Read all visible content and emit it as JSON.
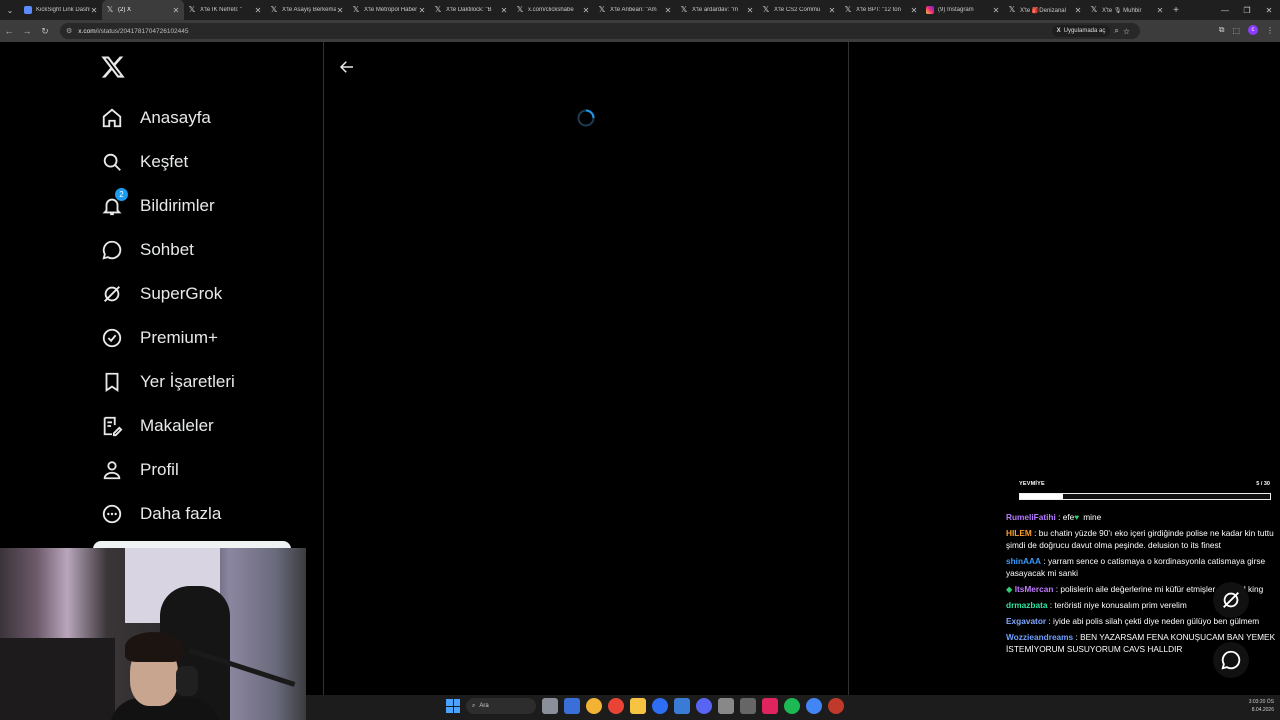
{
  "browser": {
    "tabs": [
      {
        "title": "KickSight Link Dashboard",
        "fav": "ks"
      },
      {
        "title": "(2) X",
        "fav": "x",
        "active": true
      },
      {
        "title": "X'te İK Nefreti: \"",
        "fav": "x"
      },
      {
        "title": "X'te Asayiş Berkemal",
        "fav": "x"
      },
      {
        "title": "X'te Metropol Haber",
        "fav": "x"
      },
      {
        "title": "X'te Daktilock: \"B",
        "fav": "x"
      },
      {
        "title": "x.com/clickshabe",
        "fav": "x"
      },
      {
        "title": "X'te Anbean: \"Am",
        "fav": "x"
      },
      {
        "title": "X'te ardardav: \"m",
        "fav": "x"
      },
      {
        "title": "X'te CS2 Commu",
        "fav": "x"
      },
      {
        "title": "X'te BPT: \"12 ton",
        "fav": "x"
      },
      {
        "title": "(9) Instagram",
        "fav": "ig"
      },
      {
        "title": "X'te 🎒Denizanal",
        "fav": "x"
      },
      {
        "title": "X'te 🎙 Muhbir",
        "fav": "x"
      }
    ],
    "url_host": "x.com",
    "url_path": "/i/status/2041781704726102445",
    "open_in_app": "Uygulamada aç"
  },
  "sidebar": {
    "items": [
      {
        "label": "Anasayfa",
        "icon": "home-icon"
      },
      {
        "label": "Keşfet",
        "icon": "search-icon"
      },
      {
        "label": "Bildirimler",
        "icon": "bell-icon",
        "badge": "2"
      },
      {
        "label": "Sohbet",
        "icon": "chat-icon"
      },
      {
        "label": "SuperGrok",
        "icon": "grok-icon"
      },
      {
        "label": "Premium+",
        "icon": "premium-icon"
      },
      {
        "label": "Yer İşaretleri",
        "icon": "bookmark-icon"
      },
      {
        "label": "Makaleler",
        "icon": "article-icon"
      },
      {
        "label": "Profil",
        "icon": "person-icon"
      },
      {
        "label": "Daha fazla",
        "icon": "more-icon"
      }
    ]
  },
  "overlay": {
    "goal_label": "YEVMİYE",
    "goal_count": "5 / 30",
    "goal_progress": 0.17,
    "messages": [
      {
        "user": "RumeliFatihi",
        "color": "#b57bff",
        "text": "efe",
        "heart": true,
        "after": "mine"
      },
      {
        "user": "HILEM",
        "color": "#ff9f2e",
        "text": "bu chatin yüzde 90'ı eko içeri girdiğinde polise ne kadar kin tuttu şimdi de doğrucu davut olma peşinde. delusion to its finest"
      },
      {
        "user": "shinAAA",
        "color": "#3b9cff",
        "text": "yarram sence o catismaya o kordinasyonla catismaya girse yasayacak mi sanki"
      },
      {
        "user": "ItsMercan",
        "color": "#c07bff",
        "text": "polislerin aile değerlerine mi küfür etmişler sakin ol king",
        "badge": true
      },
      {
        "user": "drmazbata",
        "color": "#2ee6a0",
        "text": "teröristi niye konusalım prim verelim"
      },
      {
        "user": "Exgavator",
        "color": "#7fa8ff",
        "text": "iyide abi polis silah çekti diye neden gülüyo ben gülmem"
      },
      {
        "user": "Wozzieandreams",
        "color": "#6ea0ff",
        "text": "BEN YAZARSAM FENA KONUŞUCAM BAN YEMEK İSTEMİYORUM SUSUYORUM CAVS HALLDIR"
      }
    ]
  },
  "taskbar": {
    "search": "Ara",
    "time": "3:03:20 ÖS",
    "date": "8.04.2026"
  },
  "colors": {
    "accent": "#1d9bf0",
    "background": "#000000",
    "text": "#e7e9ea"
  }
}
